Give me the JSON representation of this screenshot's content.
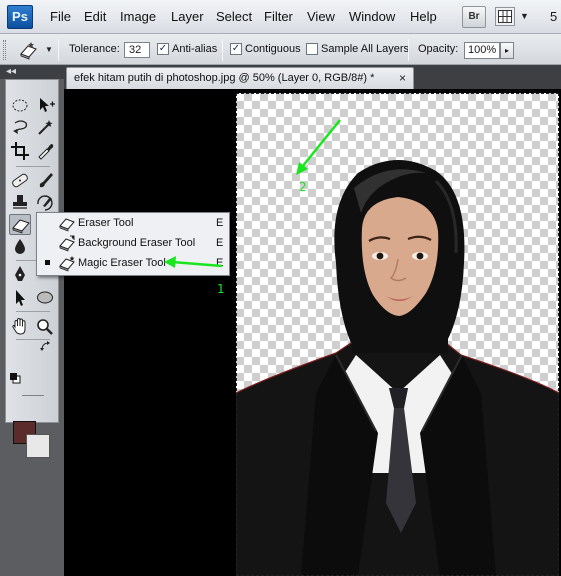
{
  "app": {
    "logo": "Ps",
    "bridge_label": "Br",
    "zoom_fragment": "5"
  },
  "menu": [
    "File",
    "Edit",
    "Image",
    "Layer",
    "Select",
    "Filter",
    "View",
    "Window",
    "Help"
  ],
  "options": {
    "tolerance_label": "Tolerance:",
    "tolerance_value": "32",
    "antialias_label": "Anti-alias",
    "antialias_checked": true,
    "contiguous_label": "Contiguous",
    "contiguous_checked": true,
    "sample_all_layers_label": "Sample All Layers",
    "sample_all_layers_checked": false,
    "opacity_label": "Opacity:",
    "opacity_value": "100%"
  },
  "tools_panel": {
    "collapse_label": "◂◂",
    "foreground_color": "#5a2b2a",
    "background_color": "#e8e8e8"
  },
  "document": {
    "tab_title": "efek hitam putih di photoshop.jpg @ 50% (Layer 0, RGB/8#) *",
    "close_label": "×"
  },
  "flyout": {
    "items": [
      {
        "label": "Eraser Tool",
        "shortcut": "E",
        "icon": "eraser-icon",
        "selected": false
      },
      {
        "label": "Background Eraser Tool",
        "shortcut": "E",
        "icon": "background-eraser-icon",
        "selected": false
      },
      {
        "label": "Magic Eraser Tool",
        "shortcut": "E",
        "icon": "magic-eraser-icon",
        "selected": true
      }
    ]
  },
  "annotations": {
    "label_1": "1",
    "label_2": "2",
    "arrow_color": "#19e61f"
  }
}
